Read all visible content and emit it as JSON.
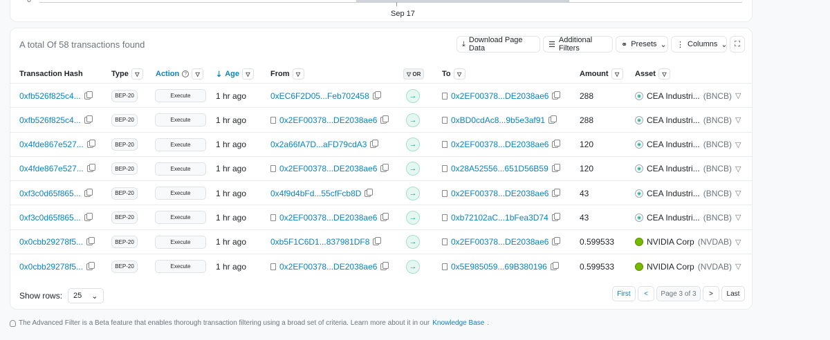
{
  "chart": {
    "y_zero": "0",
    "x_tick": "Sep 17"
  },
  "summary": "A total Of 58 transactions found",
  "toolbar": {
    "download": "Download Page Data",
    "filters": "Additional Filters",
    "presets": "Presets",
    "columns": "Columns"
  },
  "headers": {
    "hash": "Transaction Hash",
    "type": "Type",
    "action": "Action",
    "age": "Age",
    "from": "From",
    "or": "OR",
    "to": "To",
    "amount": "Amount",
    "asset": "Asset"
  },
  "rows": [
    {
      "hash": "0xfb526f825c4...",
      "type": "BEP-20",
      "action": "Execute",
      "age": "1 hr ago",
      "from": "0xEC6F2D05...Feb702458",
      "to": "0x2EF00378...DE2038ae6",
      "amount": "288",
      "asset": "CEA Industri...",
      "symbol": "(BNCB)"
    },
    {
      "hash": "0xfb526f825c4...",
      "type": "BEP-20",
      "action": "Execute",
      "age": "1 hr ago",
      "from": "0x2EF00378...DE2038ae6",
      "to": "0xBD0cdAc8...9b5e3af91",
      "amount": "288",
      "asset": "CEA Industri...",
      "symbol": "(BNCB)"
    },
    {
      "hash": "0x4fde867e527...",
      "type": "BEP-20",
      "action": "Execute",
      "age": "1 hr ago",
      "from": "0x2a66fA7D...aFD79cdA3",
      "to": "0x2EF00378...DE2038ae6",
      "amount": "120",
      "asset": "CEA Industri...",
      "symbol": "(BNCB)"
    },
    {
      "hash": "0x4fde867e527...",
      "type": "BEP-20",
      "action": "Execute",
      "age": "1 hr ago",
      "from": "0x2EF00378...DE2038ae6",
      "to": "0x28A52556...651D56B59",
      "amount": "120",
      "asset": "CEA Industri...",
      "symbol": "(BNCB)"
    },
    {
      "hash": "0xf3c0d65f865...",
      "type": "BEP-20",
      "action": "Execute",
      "age": "1 hr ago",
      "from": "0x4f9d4bFd...55cfFcb8D",
      "to": "0x2EF00378...DE2038ae6",
      "amount": "43",
      "asset": "CEA Industri...",
      "symbol": "(BNCB)"
    },
    {
      "hash": "0xf3c0d65f865...",
      "type": "BEP-20",
      "action": "Execute",
      "age": "1 hr ago",
      "from": "0x2EF00378...DE2038ae6",
      "to": "0xb72102aC...1bFea3D74",
      "amount": "43",
      "asset": "CEA Industri...",
      "symbol": "(BNCB)"
    },
    {
      "hash": "0x0cbb29278f5...",
      "type": "BEP-20",
      "action": "Execute",
      "age": "1 hr ago",
      "from": "0xb5F1C6D1...837981DF8",
      "to": "0x2EF00378...DE2038ae6",
      "amount": "0.599533",
      "asset": "NVIDIA Corp",
      "symbol": "(NVDAB)"
    },
    {
      "hash": "0x0cbb29278f5...",
      "type": "BEP-20",
      "action": "Execute",
      "age": "1 hr ago",
      "from": "0x2EF00378...DE2038ae6",
      "to": "0x5E985059...69B380196",
      "amount": "0.599533",
      "asset": "NVIDIA Corp",
      "symbol": "(NVDAB)"
    }
  ],
  "row_meta": [
    {
      "from_contract": false,
      "to_contract": true,
      "token_icon": "cea-token-icon"
    },
    {
      "from_contract": true,
      "to_contract": true,
      "token_icon": "cea-token-icon"
    },
    {
      "from_contract": false,
      "to_contract": true,
      "token_icon": "cea-token-icon"
    },
    {
      "from_contract": true,
      "to_contract": true,
      "token_icon": "cea-token-icon"
    },
    {
      "from_contract": false,
      "to_contract": true,
      "token_icon": "cea-token-icon"
    },
    {
      "from_contract": true,
      "to_contract": true,
      "token_icon": "cea-token-icon"
    },
    {
      "from_contract": false,
      "to_contract": true,
      "token_icon": "nvidia-token-icon"
    },
    {
      "from_contract": true,
      "to_contract": true,
      "token_icon": "nvidia-token-icon"
    }
  ],
  "footer": {
    "show_rows_label": "Show rows:",
    "show_rows_value": "25",
    "first": "First",
    "prev": "<",
    "page": "Page 3 of 3",
    "next": ">",
    "last": "Last"
  },
  "note": {
    "text": "The Advanced Filter is a Beta feature that enables thorough transaction filtering using a broad set of criteria. Learn more about it in our",
    "link": "Knowledge Base",
    "end": "."
  },
  "colors": {
    "link": "#0784c3",
    "arrow": "#00a186",
    "nvidia": "#76b900"
  }
}
